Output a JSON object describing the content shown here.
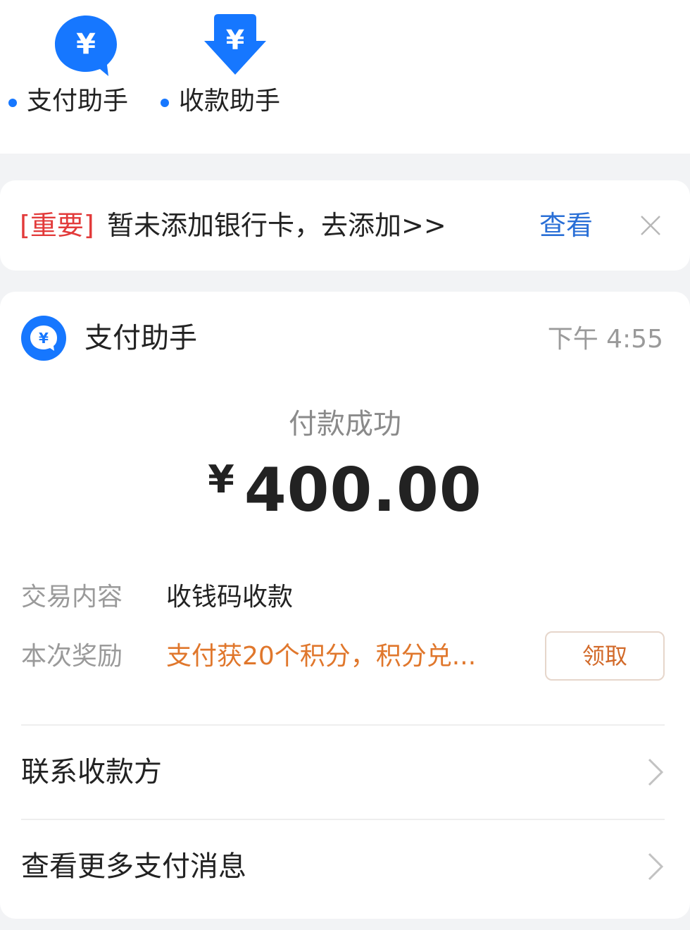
{
  "shortcuts": [
    {
      "label": "支付助手",
      "icon": "yen-chat-bubble-icon"
    },
    {
      "label": "收款助手",
      "icon": "yen-download-arrow-icon"
    }
  ],
  "notice": {
    "tag": "[重要]",
    "text": "暂未添加银行卡，去添加>>",
    "link": "查看",
    "close_icon": "close-icon"
  },
  "message": {
    "sender": "支付助手",
    "time": "下午 4:55",
    "status": "付款成功",
    "currency_symbol": "¥",
    "amount": "400.00",
    "details": [
      {
        "label": "交易内容",
        "value": "收钱码收款"
      },
      {
        "label": "本次奖励",
        "value": "支付获20个积分，积分兑...",
        "action": "领取"
      }
    ],
    "links": [
      {
        "label": "联系收款方"
      },
      {
        "label": "查看更多支付消息"
      }
    ]
  },
  "colors": {
    "accent_blue": "#1677ff",
    "notice_red": "#e23a3a",
    "link_blue": "#2a6fd6",
    "reward_orange": "#e0772c",
    "background": "#f2f3f5"
  }
}
